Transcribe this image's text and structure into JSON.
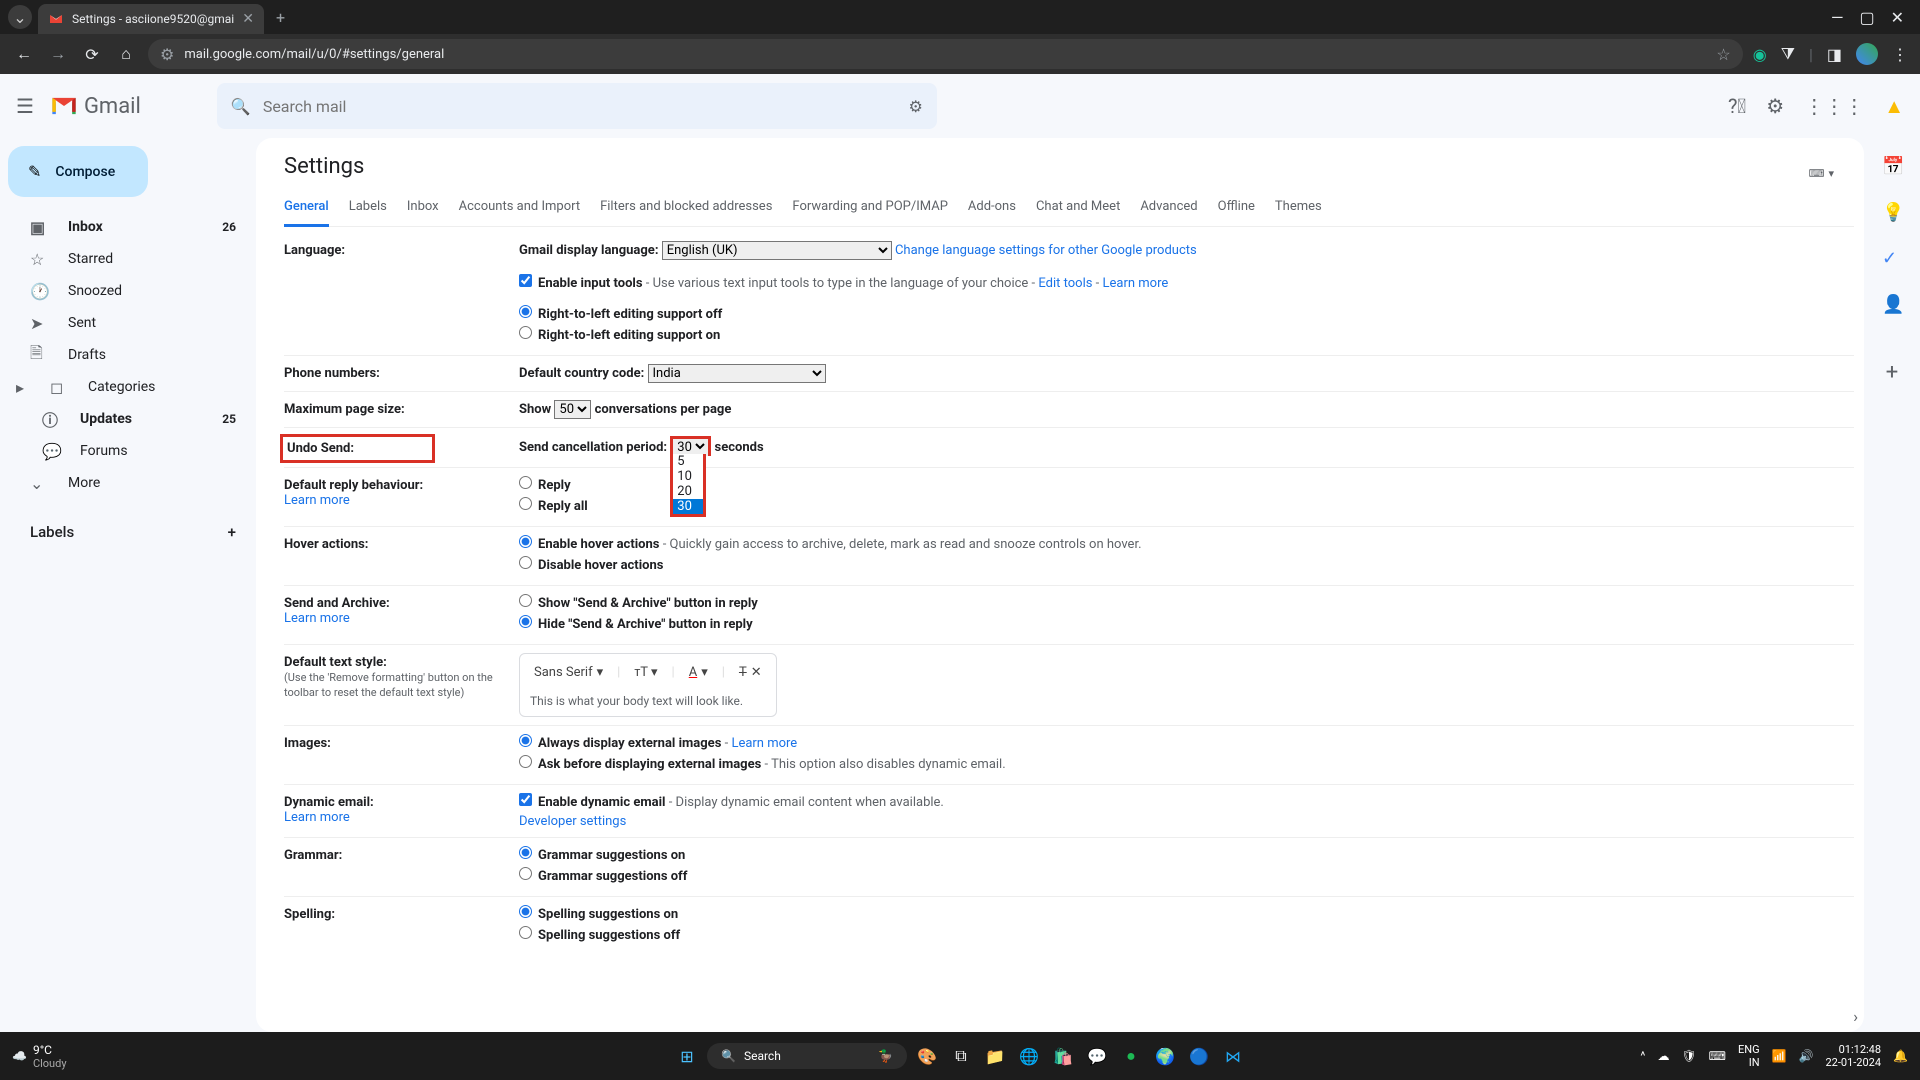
{
  "browser": {
    "tab_title": "Settings - asciione9520@gmai",
    "url": "mail.google.com/mail/u/0/#settings/general"
  },
  "header": {
    "brand": "Gmail",
    "search_placeholder": "Search mail"
  },
  "compose_label": "Compose",
  "sidebar": {
    "items": [
      {
        "icon": "inbox",
        "label": "Inbox",
        "count": "26",
        "bold": true
      },
      {
        "icon": "star",
        "label": "Starred"
      },
      {
        "icon": "clock",
        "label": "Snoozed"
      },
      {
        "icon": "send",
        "label": "Sent"
      },
      {
        "icon": "file",
        "label": "Drafts"
      },
      {
        "icon": "caret",
        "label": "Categories"
      },
      {
        "icon": "info",
        "label": "Updates",
        "count": "25",
        "bold": true,
        "indent": true
      },
      {
        "icon": "forum",
        "label": "Forums",
        "indent": true
      },
      {
        "icon": "more",
        "label": "More"
      }
    ],
    "labels_header": "Labels"
  },
  "settings": {
    "title": "Settings",
    "tabs": [
      "General",
      "Labels",
      "Inbox",
      "Accounts and Import",
      "Filters and blocked addresses",
      "Forwarding and POP/IMAP",
      "Add-ons",
      "Chat and Meet",
      "Advanced",
      "Offline",
      "Themes"
    ],
    "language": {
      "label": "Language:",
      "display_label": "Gmail display language:",
      "selected": "English (UK)",
      "change_link": "Change language settings for other Google products",
      "enable_input": "Enable input tools",
      "input_desc": " - Use various text input tools to type in the language of your choice - ",
      "edit_tools": "Edit tools",
      "learn_more": "Learn more",
      "rtl_off": "Right-to-left editing support off",
      "rtl_on": "Right-to-left editing support on"
    },
    "phone": {
      "label": "Phone numbers:",
      "cc_label": "Default country code:",
      "cc_value": "India"
    },
    "pagesize": {
      "label": "Maximum page size:",
      "show": "Show",
      "value": "50",
      "suffix": "conversations per page"
    },
    "undo": {
      "label": "Undo Send:",
      "period_label": "Send cancellation period:",
      "value": "30",
      "suffix": "seconds",
      "options": [
        "5",
        "10",
        "20",
        "30"
      ]
    },
    "reply": {
      "label": "Default reply behaviour:",
      "learn": "Learn more",
      "opt1": "Reply",
      "opt2": "Reply all"
    },
    "hover": {
      "label": "Hover actions:",
      "enable": "Enable hover actions",
      "enable_desc": " - Quickly gain access to archive, delete, mark as read and snooze controls on hover.",
      "disable": "Disable hover actions"
    },
    "archive": {
      "label": "Send and Archive:",
      "learn": "Learn more",
      "show": "Show \"Send & Archive\" button in reply",
      "hide": "Hide \"Send & Archive\" button in reply"
    },
    "textstyle": {
      "label": "Default text style:",
      "sub": "(Use the 'Remove formatting' button on the toolbar to reset the default text style)",
      "font": "Sans Serif",
      "preview": "This is what your body text will look like."
    },
    "images": {
      "label": "Images:",
      "always": "Always display external images",
      "learn": "Learn more",
      "ask": "Ask before displaying external images",
      "ask_desc": " - This option also disables dynamic email."
    },
    "dynamic": {
      "label": "Dynamic email:",
      "learn": "Learn more",
      "enable": "Enable dynamic email",
      "desc": " - Display dynamic email content when available.",
      "dev": "Developer settings"
    },
    "grammar": {
      "label": "Grammar:",
      "on": "Grammar suggestions on",
      "off": "Grammar suggestions off"
    },
    "spelling": {
      "label": "Spelling:",
      "on": "Spelling suggestions on",
      "off": "Spelling suggestions off"
    }
  },
  "taskbar": {
    "temp": "9°C",
    "weather": "Cloudy",
    "search": "Search",
    "lang1": "ENG",
    "lang2": "IN",
    "time": "01:12:48",
    "date": "22-01-2024"
  }
}
